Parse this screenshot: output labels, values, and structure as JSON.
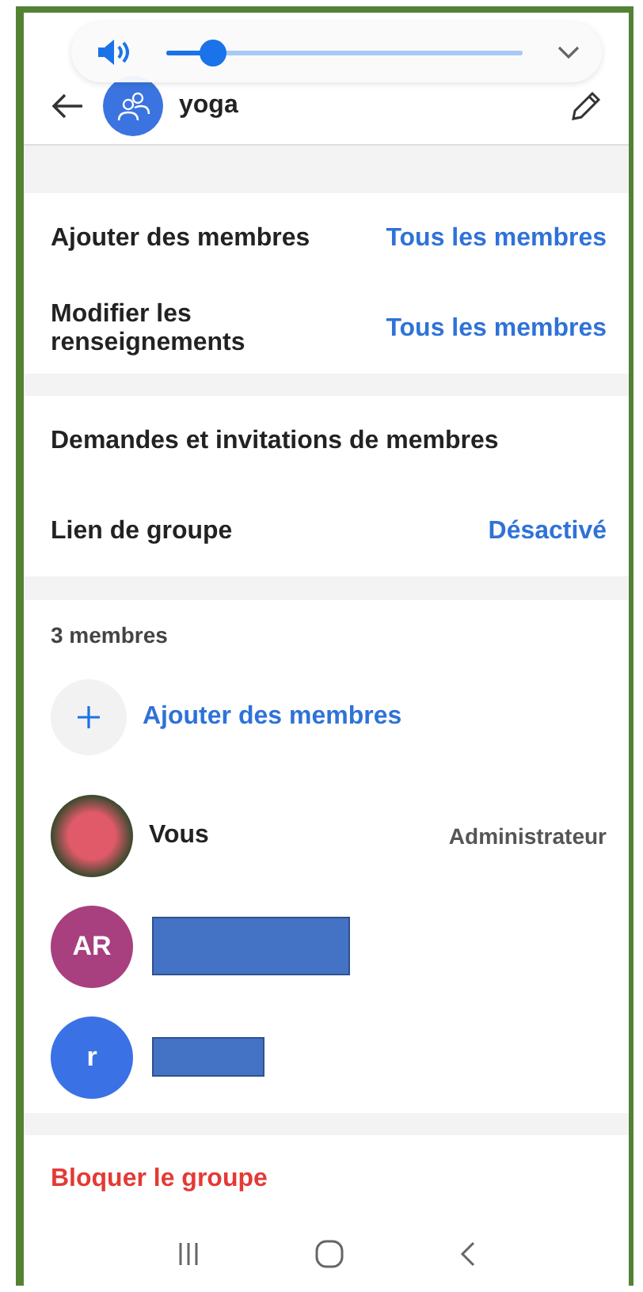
{
  "volume": {
    "level": 0.13
  },
  "header": {
    "title": "yoga"
  },
  "settings": [
    {
      "label": "Ajouter des membres",
      "value": "Tous les membres"
    },
    {
      "label": "Modifier les renseignements",
      "value": "Tous les membres"
    }
  ],
  "requests": [
    {
      "label": "Demandes et invitations de membres"
    },
    {
      "label": "Lien de groupe",
      "value": "Désactivé"
    }
  ],
  "members": {
    "count": "3 membres",
    "add_label": "Ajouter des membres",
    "list": [
      {
        "kind": "photo",
        "name": "Vous",
        "role": "Administrateur"
      },
      {
        "kind": "initials",
        "initials": "AR",
        "color": "#a8407f",
        "redacted": true
      },
      {
        "kind": "initials",
        "initials": "r",
        "color": "#3a72e6",
        "redacted": true
      }
    ]
  },
  "block": {
    "label": "Bloquer le groupe"
  }
}
